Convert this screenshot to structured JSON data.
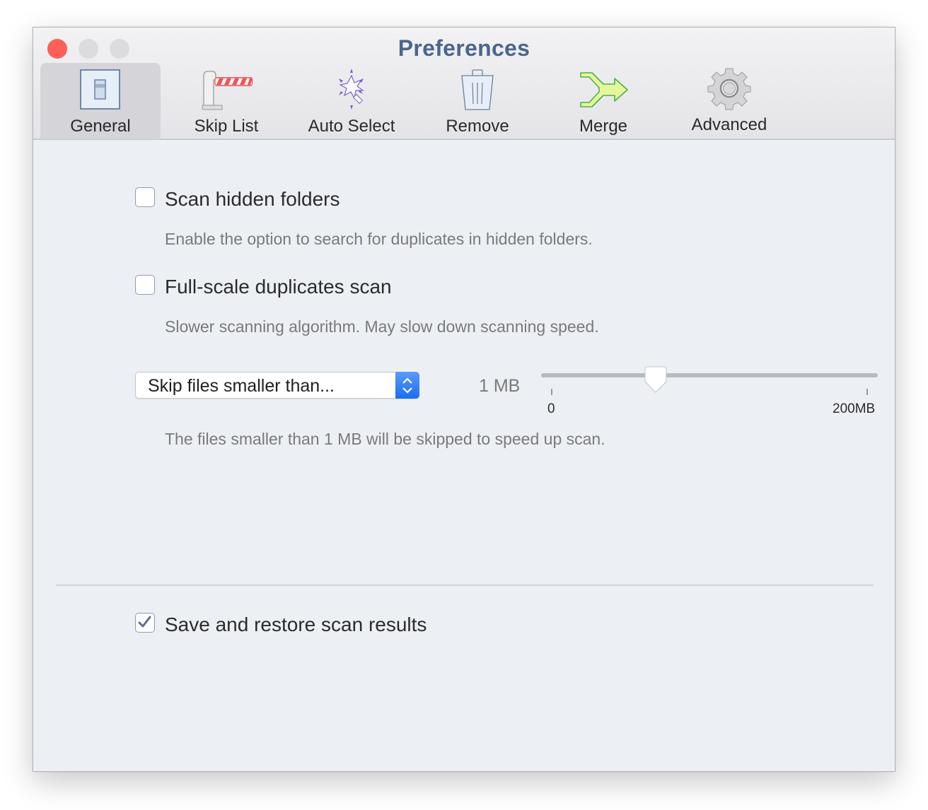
{
  "window": {
    "title": "Preferences"
  },
  "toolbar": {
    "tabs": [
      {
        "label": "General",
        "icon": "general-switch-icon",
        "selected": true
      },
      {
        "label": "Skip List",
        "icon": "barrier-gate-icon",
        "selected": false
      },
      {
        "label": "Auto Select",
        "icon": "magic-wand-icon",
        "selected": false
      },
      {
        "label": "Remove",
        "icon": "trash-icon",
        "selected": false
      },
      {
        "label": "Merge",
        "icon": "merge-arrow-icon",
        "selected": false
      },
      {
        "label": "Advanced",
        "icon": "gear-icon",
        "selected": false
      }
    ]
  },
  "general": {
    "scan_hidden": {
      "label": "Scan hidden folders",
      "checked": false,
      "description": "Enable the option to search for duplicates in hidden folders."
    },
    "full_scale": {
      "label": "Full-scale duplicates scan",
      "checked": false,
      "description": "Slower scanning algorithm. May slow down scanning speed."
    },
    "skip_small": {
      "select_value": "Skip files smaller than...",
      "size_value": "1 MB",
      "slider": {
        "min_label": "0",
        "max_label": "200MB",
        "position_fraction": 0.34
      },
      "description": "The files smaller than 1 MB will be skipped to speed up scan."
    },
    "save_restore": {
      "label": "Save and restore scan results",
      "checked": true
    }
  },
  "colors": {
    "title": "#4a6690",
    "close_button": "#fe5f57",
    "accent_blue": "#1c6cf2",
    "checkmark": "#5a6f96"
  }
}
